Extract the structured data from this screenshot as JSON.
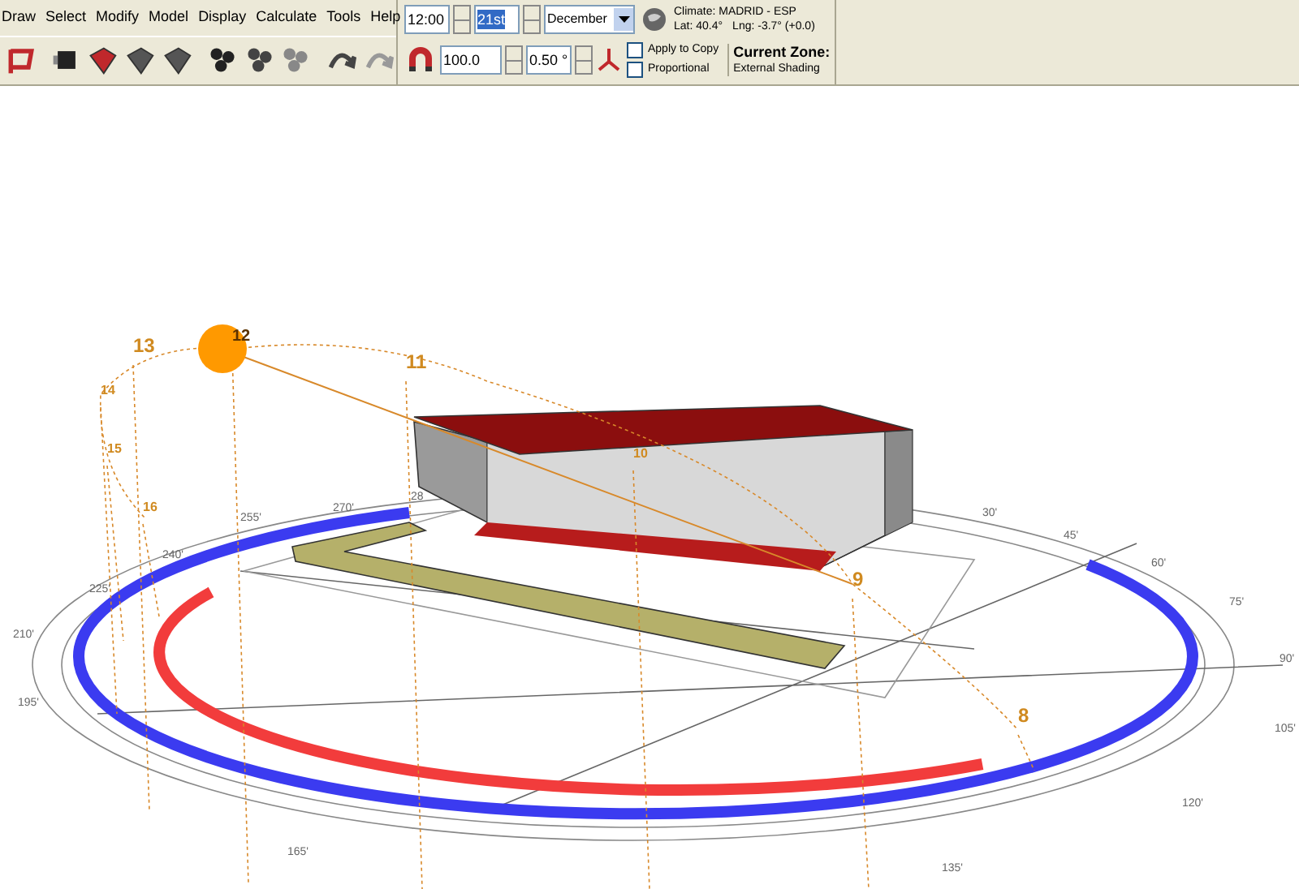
{
  "menu": [
    {
      "label": "Draw"
    },
    {
      "label": "Select"
    },
    {
      "label": "Modify"
    },
    {
      "label": "Model"
    },
    {
      "label": "Display"
    },
    {
      "label": "Calculate"
    },
    {
      "label": "Tools"
    },
    {
      "label": "Help"
    }
  ],
  "date_time": {
    "time": "12:00",
    "day": "21st",
    "day_selected": true,
    "month": "December"
  },
  "climate": {
    "title": "Climate: MADRID - ESP",
    "lat": "Lat: 40.4°",
    "lng": "Lng: -3.7° (+0.0)"
  },
  "snap": {
    "grid": "100.0",
    "angle": "0.50 °"
  },
  "options": [
    {
      "label": "Apply to Copy",
      "checked": false
    },
    {
      "label": "Proportional",
      "checked": false
    }
  ],
  "current_zone": {
    "title": "Current Zone:",
    "name": "External Shading"
  },
  "compass_labels": [
    "30'",
    "45'",
    "60'",
    "75'",
    "90'",
    "105'",
    "120'",
    "135'",
    "165'",
    "195'",
    "210'",
    "225'",
    "240'",
    "255'",
    "270'",
    "28"
  ],
  "hour_labels": [
    "8",
    "9",
    "10",
    "11",
    "12",
    "13",
    "14",
    "15",
    "16"
  ]
}
